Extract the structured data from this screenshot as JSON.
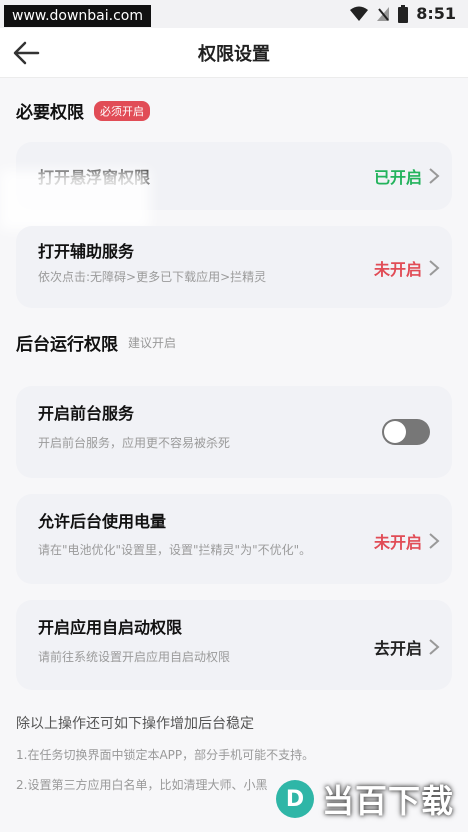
{
  "status": {
    "watermark": "www.downbai.com",
    "time": "8:51"
  },
  "appbar": {
    "title": "权限设置"
  },
  "required": {
    "title": "必要权限",
    "badge": "必须开启",
    "items": [
      {
        "title": "打开悬浮窗权限",
        "desc": "",
        "state": "已开启"
      },
      {
        "title": "打开辅助服务",
        "desc": "依次点击:无障碍>更多已下载应用>拦精灵",
        "state": "未开启"
      }
    ]
  },
  "background": {
    "title": "后台运行权限",
    "hint": "建议开启",
    "items": [
      {
        "title": "开启前台服务",
        "desc": "开启前台服务，应用更不容易被杀死",
        "toggle_on": false
      },
      {
        "title": "允许后台使用电量",
        "desc": "请在\"电池优化\"设置里，设置\"拦精灵\"为\"不优化\"。",
        "state": "未开启"
      },
      {
        "title": "开启应用自启动权限",
        "desc": "请前往系统设置开启应用自启动权限",
        "state": "去开启"
      }
    ]
  },
  "footer": {
    "note": "除以上操作还可如下操作增加后台稳定",
    "line1": "1.在任务切换界面中锁定本APP，部分手机可能不支持。",
    "line2": "2.设置第三方应用白名单，比如清理大师、小黑"
  },
  "logo_watermark": {
    "glyph": "D",
    "text": "当百下载"
  },
  "colors": {
    "on": "#23b35c",
    "off": "#e14c56",
    "card": "#f1f2f6",
    "badge": "#e14c56"
  }
}
